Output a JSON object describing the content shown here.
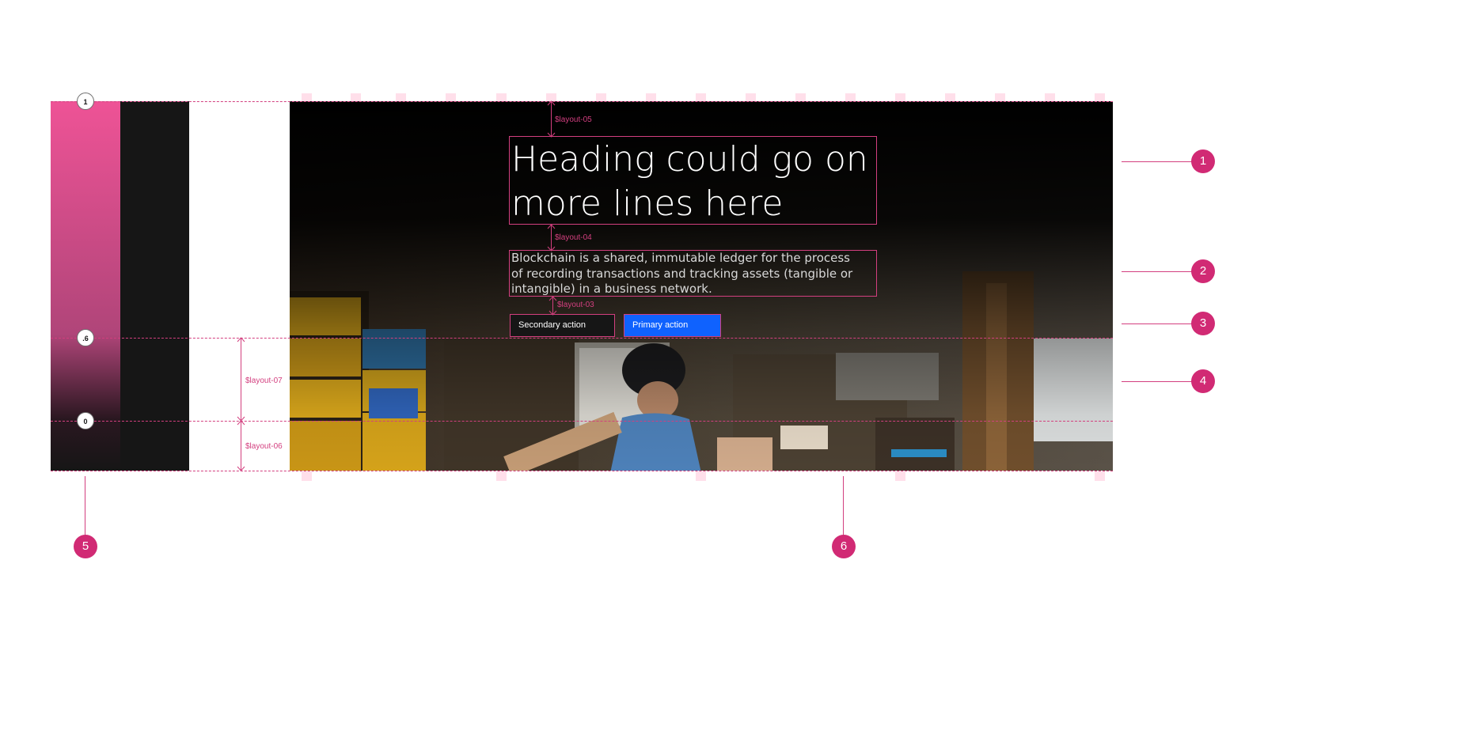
{
  "hero": {
    "heading_line_1": "Heading could go on",
    "heading_line_2": "more lines here",
    "body": "Blockchain is a shared, immutable ledger for the process of recording transactions and tracking assets (tangible or intangible) in a business network.",
    "secondary_action": "Secondary action",
    "primary_action": "Primary action"
  },
  "spacing_tokens": {
    "top": "$layout-05",
    "heading_to_body": "$layout-04",
    "body_to_buttons": "$layout-03",
    "gradient_fade": "$layout-07",
    "solid_bottom": "$layout-06"
  },
  "gradient_stops": [
    "1",
    ".6",
    "0"
  ],
  "callouts": [
    "1",
    "2",
    "3",
    "4",
    "5",
    "6"
  ],
  "colors": {
    "annotation": "#d33f7f",
    "callout": "#d12a74",
    "gradient_top": "#ee5396",
    "dark": "#161616",
    "primary": "#0f62fe"
  }
}
